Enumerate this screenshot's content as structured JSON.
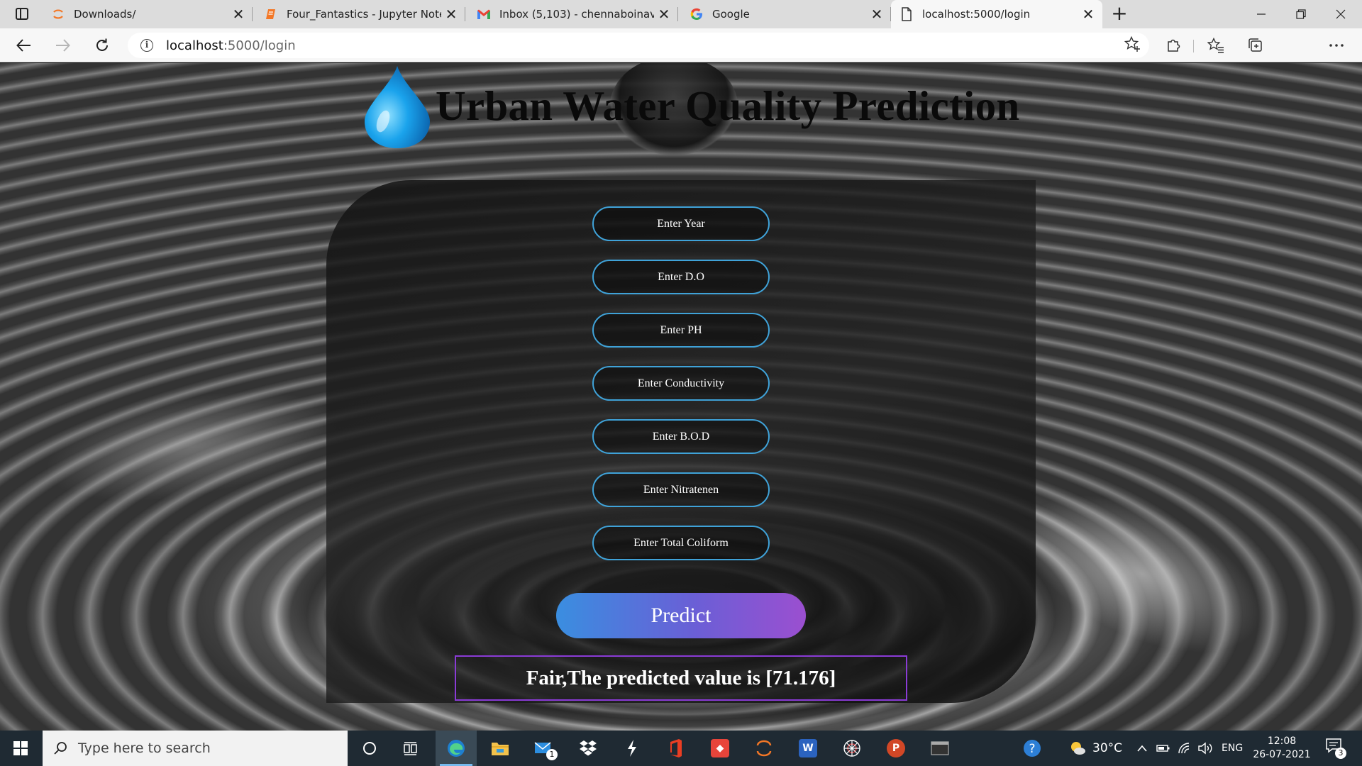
{
  "browser": {
    "tabs": [
      {
        "title": "Downloads/",
        "icon": "jupyter-icon"
      },
      {
        "title": "Four_Fantastics - Jupyter Notebc",
        "icon": "notebook-icon"
      },
      {
        "title": "Inbox (5,103) - chennaboinavaru",
        "icon": "gmail-icon"
      },
      {
        "title": "Google",
        "icon": "google-icon"
      },
      {
        "title": "localhost:5000/login",
        "icon": "page-icon"
      }
    ],
    "address": {
      "host": "localhost",
      "path": ":5000/login"
    }
  },
  "page": {
    "title": "Urban Water Quality Prediction",
    "fields": [
      {
        "placeholder": "Enter Year",
        "value": ""
      },
      {
        "placeholder": "Enter D.O",
        "value": ""
      },
      {
        "placeholder": "Enter PH",
        "value": ""
      },
      {
        "placeholder": "Enter Conductivity",
        "value": ""
      },
      {
        "placeholder": "Enter B.O.D",
        "value": ""
      },
      {
        "placeholder": "Enter Nitratenen",
        "value": ""
      },
      {
        "placeholder": "Enter Total Coliform",
        "value": ""
      }
    ],
    "predict_label": "Predict",
    "result": "Fair,The predicted value is [71.176]"
  },
  "taskbar": {
    "search_placeholder": "Type here to search",
    "mail_badge": "1",
    "weather": "30°C",
    "language": "ENG",
    "time": "12:08",
    "date": "26-07-2021",
    "notification_count": "3"
  },
  "colors": {
    "field_border": "#3fa2d8",
    "button_gradient_start": "#3a8ee0",
    "button_gradient_end": "#9b4fd0",
    "result_border": "#8a3bd6"
  }
}
